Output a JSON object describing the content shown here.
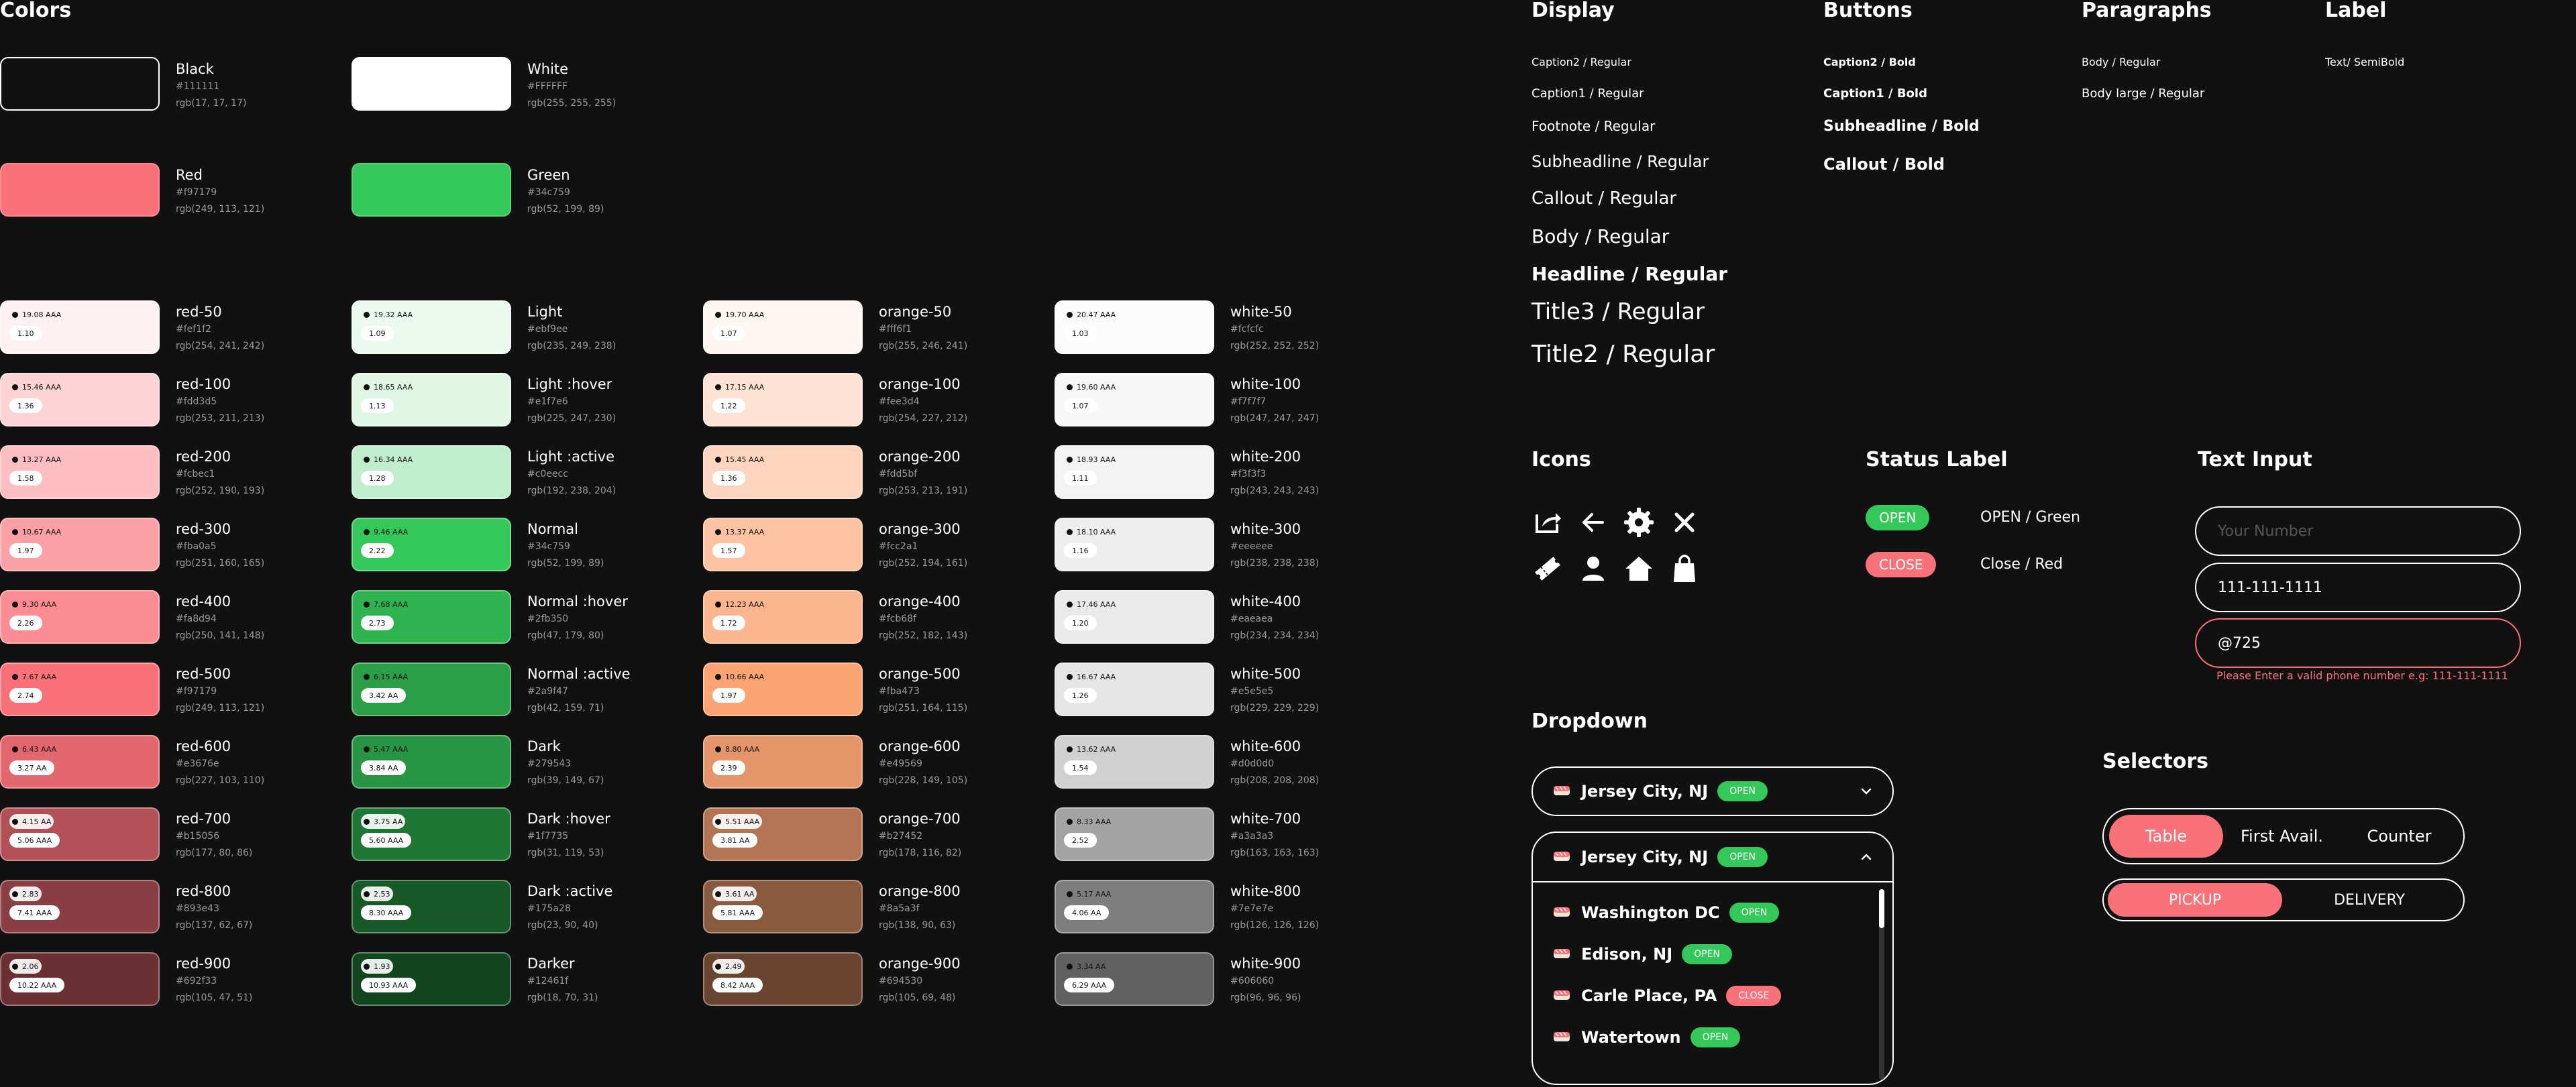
{
  "colors_title": "Colors",
  "base_colors": [
    {
      "name": "Black",
      "hex": "#111111",
      "rgb": "rgb(17, 17, 17)",
      "fill": "#111111"
    },
    {
      "name": "White",
      "hex": "#FFFFFF",
      "rgb": "rgb(255, 255, 255)",
      "fill": "#ffffff"
    },
    {
      "name": "Red",
      "hex": "#f97179",
      "rgb": "rgb(249, 113, 121)",
      "fill": "#f97179"
    },
    {
      "name": "Green",
      "hex": "#34c759",
      "rgb": "rgb(52, 199, 89)",
      "fill": "#34c759"
    }
  ],
  "palettes": {
    "red": [
      {
        "name": "red-50",
        "hex": "#fef1f2",
        "rgb": "rgb(254, 241, 242)",
        "fill": "#fef1f2",
        "c1": "19.08 AAA",
        "c2": "1.10",
        "light": false
      },
      {
        "name": "red-100",
        "hex": "#fdd3d5",
        "rgb": "rgb(253, 211, 213)",
        "fill": "#fdd3d5",
        "c1": "15.46 AAA",
        "c2": "1.36",
        "light": false
      },
      {
        "name": "red-200",
        "hex": "#fcbec1",
        "rgb": "rgb(252, 190, 193)",
        "fill": "#fcbec1",
        "c1": "13.27 AAA",
        "c2": "1.58",
        "light": false
      },
      {
        "name": "red-300",
        "hex": "#fba0a5",
        "rgb": "rgb(251, 160, 165)",
        "fill": "#fba0a5",
        "c1": "10.67 AAA",
        "c2": "1.97",
        "light": false
      },
      {
        "name": "red-400",
        "hex": "#fa8d94",
        "rgb": "rgb(250, 141, 148)",
        "fill": "#fa8d94",
        "c1": "9.30 AAA",
        "c2": "2.26",
        "light": false
      },
      {
        "name": "red-500",
        "hex": "#f97179",
        "rgb": "rgb(249, 113, 121)",
        "fill": "#f97179",
        "c1": "7.67 AAA",
        "c2": "2.74",
        "light": false
      },
      {
        "name": "red-600",
        "hex": "#e3676e",
        "rgb": "rgb(227, 103, 110)",
        "fill": "#e3676e",
        "c1": "6.43 AAA",
        "c2": "3.27 AA",
        "light": false
      },
      {
        "name": "red-700",
        "hex": "#b15056",
        "rgb": "rgb(177, 80, 86)",
        "fill": "#b15056",
        "c1": "4.15 AA",
        "c2": "5.06 AAA",
        "light": true
      },
      {
        "name": "red-800",
        "hex": "#893e43",
        "rgb": "rgb(137, 62, 67)",
        "fill": "#893e43",
        "c1": "2.83",
        "c2": "7.41 AAA",
        "light": true
      },
      {
        "name": "red-900",
        "hex": "#692f33",
        "rgb": "rgb(105, 47, 51)",
        "fill": "#692f33",
        "c1": "2.06",
        "c2": "10.22 AAA",
        "light": true
      }
    ],
    "green": [
      {
        "name": "Light",
        "hex": "#ebf9ee",
        "rgb": "rgb(235, 249, 238)",
        "fill": "#ebf9ee",
        "c1": "19.32 AAA",
        "c2": "1.09",
        "light": false
      },
      {
        "name": "Light :hover",
        "hex": "#e1f7e6",
        "rgb": "rgb(225, 247, 230)",
        "fill": "#e1f7e6",
        "c1": "18.65 AAA",
        "c2": "1.13",
        "light": false
      },
      {
        "name": "Light :active",
        "hex": "#c0eecc",
        "rgb": "rgb(192, 238, 204)",
        "fill": "#c0eecc",
        "c1": "16.34 AAA",
        "c2": "1.28",
        "light": false
      },
      {
        "name": "Normal",
        "hex": "#34c759",
        "rgb": "rgb(52, 199, 89)",
        "fill": "#34c759",
        "c1": "9.46 AAA",
        "c2": "2.22",
        "light": false
      },
      {
        "name": "Normal :hover",
        "hex": "#2fb350",
        "rgb": "rgb(47, 179, 80)",
        "fill": "#2fb350",
        "c1": "7.68 AAA",
        "c2": "2.73",
        "light": false
      },
      {
        "name": "Normal :active",
        "hex": "#2a9f47",
        "rgb": "rgb(42, 159, 71)",
        "fill": "#2a9f47",
        "c1": "6.15 AAA",
        "c2": "3.42 AA",
        "light": false
      },
      {
        "name": "Dark",
        "hex": "#279543",
        "rgb": "rgb(39, 149, 67)",
        "fill": "#279543",
        "c1": "5.47 AAA",
        "c2": "3.84 AA",
        "light": false
      },
      {
        "name": "Dark :hover",
        "hex": "#1f7735",
        "rgb": "rgb(31, 119, 53)",
        "fill": "#1f7735",
        "c1": "3.75 AA",
        "c2": "5.60 AAA",
        "light": true
      },
      {
        "name": "Dark :active",
        "hex": "#175a28",
        "rgb": "rgb(23, 90, 40)",
        "fill": "#175a28",
        "c1": "2.53",
        "c2": "8.30 AAA",
        "light": true
      },
      {
        "name": "Darker",
        "hex": "#12461f",
        "rgb": "rgb(18, 70, 31)",
        "fill": "#12461f",
        "c1": "1.93",
        "c2": "10.93 AAA",
        "light": true
      }
    ],
    "orange": [
      {
        "name": "orange-50",
        "hex": "#fff6f1",
        "rgb": "rgb(255, 246, 241)",
        "fill": "#fff6f1",
        "c1": "19.70 AAA",
        "c2": "1.07",
        "light": false
      },
      {
        "name": "orange-100",
        "hex": "#fee3d4",
        "rgb": "rgb(254, 227, 212)",
        "fill": "#fee3d4",
        "c1": "17.15 AAA",
        "c2": "1.22",
        "light": false
      },
      {
        "name": "orange-200",
        "hex": "#fdd5bf",
        "rgb": "rgb(253, 213, 191)",
        "fill": "#fdd5bf",
        "c1": "15.45 AAA",
        "c2": "1.36",
        "light": false
      },
      {
        "name": "orange-300",
        "hex": "#fcc2a1",
        "rgb": "rgb(252, 194, 161)",
        "fill": "#fcc2a1",
        "c1": "13.37 AAA",
        "c2": "1.57",
        "light": false
      },
      {
        "name": "orange-400",
        "hex": "#fcb68f",
        "rgb": "rgb(252, 182, 143)",
        "fill": "#fcb68f",
        "c1": "12.23 AAA",
        "c2": "1.72",
        "light": false
      },
      {
        "name": "orange-500",
        "hex": "#fba473",
        "rgb": "rgb(251, 164, 115)",
        "fill": "#fba473",
        "c1": "10.66 AAA",
        "c2": "1.97",
        "light": false
      },
      {
        "name": "orange-600",
        "hex": "#e49569",
        "rgb": "rgb(228, 149, 105)",
        "fill": "#e49569",
        "c1": "8.80 AAA",
        "c2": "2.39",
        "light": false
      },
      {
        "name": "orange-700",
        "hex": "#b27452",
        "rgb": "rgb(178, 116, 82)",
        "fill": "#b27452",
        "c1": "5.51 AAA",
        "c2": "3.81 AA",
        "light": true
      },
      {
        "name": "orange-800",
        "hex": "#8a5a3f",
        "rgb": "rgb(138, 90, 63)",
        "fill": "#8a5a3f",
        "c1": "3.61 AA",
        "c2": "5.81 AAA",
        "light": true
      },
      {
        "name": "orange-900",
        "hex": "#694530",
        "rgb": "rgb(105, 69, 48)",
        "fill": "#694530",
        "c1": "2.49",
        "c2": "8.42 AAA",
        "light": true
      }
    ],
    "white": [
      {
        "name": "white-50",
        "hex": "#fcfcfc",
        "rgb": "rgb(252, 252, 252)",
        "fill": "#fcfcfc",
        "c1": "20.47 AAA",
        "c2": "1.03",
        "light": false
      },
      {
        "name": "white-100",
        "hex": "#f7f7f7",
        "rgb": "rgb(247, 247, 247)",
        "fill": "#f7f7f7",
        "c1": "19.60 AAA",
        "c2": "1.07",
        "light": false
      },
      {
        "name": "white-200",
        "hex": "#f3f3f3",
        "rgb": "rgb(243, 243, 243)",
        "fill": "#f3f3f3",
        "c1": "18.93 AAA",
        "c2": "1.11",
        "light": false
      },
      {
        "name": "white-300",
        "hex": "#eeeeee",
        "rgb": "rgb(238, 238, 238)",
        "fill": "#eeeeee",
        "c1": "18.10 AAA",
        "c2": "1.16",
        "light": false
      },
      {
        "name": "white-400",
        "hex": "#eaeaea",
        "rgb": "rgb(234, 234, 234)",
        "fill": "#eaeaea",
        "c1": "17.46 AAA",
        "c2": "1.20",
        "light": false
      },
      {
        "name": "white-500",
        "hex": "#e5e5e5",
        "rgb": "rgb(229, 229, 229)",
        "fill": "#e5e5e5",
        "c1": "16.67 AAA",
        "c2": "1.26",
        "light": false
      },
      {
        "name": "white-600",
        "hex": "#d0d0d0",
        "rgb": "rgb(208, 208, 208)",
        "fill": "#d0d0d0",
        "c1": "13.62 AAA",
        "c2": "1.54",
        "light": false
      },
      {
        "name": "white-700",
        "hex": "#a3a3a3",
        "rgb": "rgb(163, 163, 163)",
        "fill": "#a3a3a3",
        "c1": "8.33 AAA",
        "c2": "2.52",
        "light": false
      },
      {
        "name": "white-800",
        "hex": "#7e7e7e",
        "rgb": "rgb(126, 126, 126)",
        "fill": "#7e7e7e",
        "c1": "5.17 AAA",
        "c2": "4.06 AA",
        "light": false
      },
      {
        "name": "white-900",
        "hex": "#606060",
        "rgb": "rgb(96, 96, 96)",
        "fill": "#606060",
        "c1": "3.34 AA",
        "c2": "6.29 AAA",
        "light": false
      }
    ]
  },
  "typography": {
    "display": {
      "title": "Display",
      "items": [
        "Caption2 / Regular",
        "Caption1 / Regular",
        "Footnote / Regular",
        "Subheadline / Regular",
        "Callout / Regular",
        "Body / Regular",
        "Headline / Regular",
        "Title3 / Regular",
        "Title2 / Regular"
      ]
    },
    "buttons": {
      "title": "Buttons",
      "items": [
        "Caption2 / Bold",
        "Caption1 / Bold",
        "Subheadline / Bold",
        "Callout / Bold"
      ]
    },
    "paragraphs": {
      "title": "Paragraphs",
      "items": [
        "Body / Regular",
        "Body large / Regular"
      ]
    },
    "label": {
      "title": "Label",
      "items": [
        "Text/ SemiBold"
      ]
    }
  },
  "icons": {
    "title": "Icons",
    "items": [
      "share-icon",
      "arrow-left-icon",
      "gear-icon",
      "close-icon",
      "ticket-icon",
      "user-icon",
      "home-icon",
      "bag-icon"
    ]
  },
  "status_label": {
    "title": "Status Label",
    "open": {
      "label": "OPEN",
      "desc": "OPEN / Green",
      "color": "#34c759"
    },
    "close": {
      "label": "CLOSE",
      "desc": "Close / Red",
      "color": "#f97179"
    }
  },
  "text_input": {
    "title": "Text Input",
    "placeholder": "Your Number",
    "filled_value": "111-111-1111",
    "error_value": "@725",
    "error_message": "Please Enter a valid phone number e.g: 111-111-1111"
  },
  "dropdown": {
    "title": "Dropdown",
    "selected": {
      "location": "Jersey City, NJ",
      "status": "OPEN"
    },
    "options": [
      {
        "location": "Washington DC",
        "status": "OPEN"
      },
      {
        "location": "Edison, NJ",
        "status": "OPEN"
      },
      {
        "location": "Carle Place, PA",
        "status": "CLOSE"
      },
      {
        "location": "Watertown",
        "status": "OPEN"
      }
    ]
  },
  "selectors": {
    "title": "Selectors",
    "group1": [
      "Table",
      "First Avail.",
      "Counter"
    ],
    "group2": [
      "PICKUP",
      "DELIVERY"
    ],
    "accent": "#f97179"
  }
}
